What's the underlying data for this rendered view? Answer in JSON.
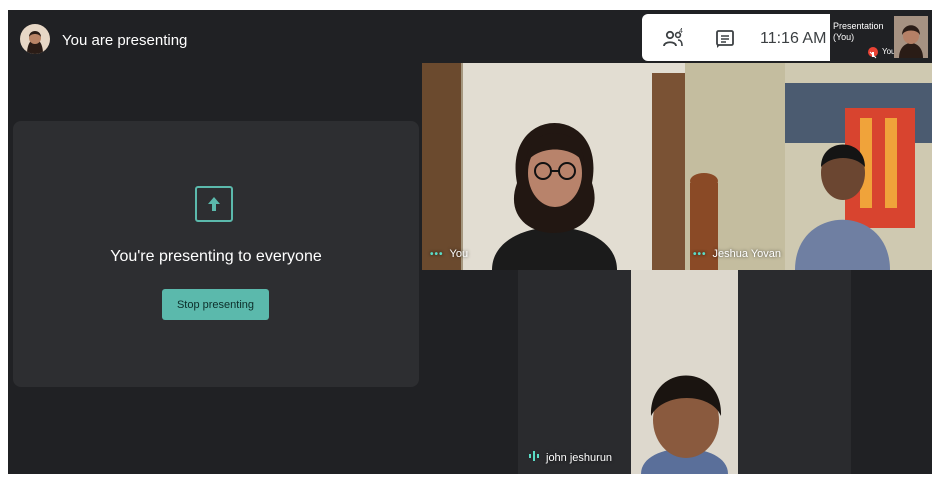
{
  "header": {
    "title": "You are presenting",
    "time": "11:16 AM",
    "self_tile": {
      "label": "Presentation\n(You)",
      "name": "You"
    }
  },
  "presentation": {
    "message": "You're presenting to everyone",
    "stop_button": "Stop presenting"
  },
  "participants": [
    {
      "name": "You",
      "indicator": "more-options-dots"
    },
    {
      "name": "Jeshua Yovan",
      "indicator": "more-options-dots"
    },
    {
      "name": "john jeshurun",
      "indicator": "speaking-audio-bars"
    }
  ],
  "colors": {
    "background": "#202124",
    "card": "#2d2e31",
    "accent": "#5bb9ac",
    "mic_off": "#ea4335"
  },
  "icons": [
    "people-icon",
    "chat-icon",
    "present-screen-icon",
    "mic-off-icon"
  ]
}
